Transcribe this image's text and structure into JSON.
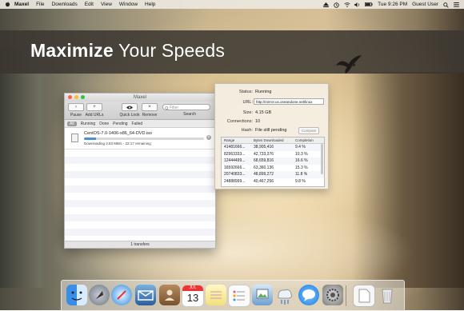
{
  "menubar": {
    "app": "Maxel",
    "items": [
      "File",
      "Downloads",
      "Edit",
      "View",
      "Window",
      "Help"
    ],
    "clock": "Tue 9:26 PM",
    "user": "Guest User"
  },
  "banner": {
    "bold": "Maximize",
    "rest": " Your Speeds"
  },
  "window": {
    "title": "Maxel",
    "toolbar": {
      "pause": "Pause",
      "add_urls": "Add URLs",
      "quick_look": "Quick Look",
      "remove": "Remove",
      "search_placeholder": "Filter",
      "search_label": "Search"
    },
    "filters": [
      "All",
      "Running",
      "Done",
      "Pending",
      "Failed"
    ],
    "download": {
      "file_name": "CentOS-7.0-1406-x86_64-DVD.iso",
      "progress_text": "Downloading 2.83 MB/s - 22:17 remaining",
      "progress": 0.1
    },
    "status": "1 transfers"
  },
  "info": {
    "status_label": "Status:",
    "status_value": "Running",
    "url_label": "URL:",
    "url_value": "http://mirror.us.oneandone.net/linux",
    "size_label": "Size:",
    "size_value": "4.15 GB",
    "connections_label": "Connections:",
    "connections_value": "10",
    "hash_label": "Hash:",
    "hash_value": "File still pending",
    "compute_label": "Compute",
    "columns": [
      "Range",
      "Bytes Downloaded",
      "Completion"
    ],
    "rows": [
      [
        "41481666...",
        "38,905,416",
        "9.4 %"
      ],
      [
        "82963333...",
        "42,733,376",
        "10.3 %"
      ],
      [
        "12444499...",
        "68,659,816",
        "16.6 %"
      ],
      [
        "16592666...",
        "63,360,136",
        "15.3 %"
      ],
      [
        "20740833...",
        "48,899,272",
        "11.8 %"
      ],
      [
        "24888999...",
        "40,467,256",
        "9.8 %"
      ]
    ]
  },
  "dock": {
    "calendar_month": "JUL",
    "calendar_day": "13"
  },
  "colors": {
    "progress": "#4a90d9",
    "banner_bg": "#3a3630"
  }
}
